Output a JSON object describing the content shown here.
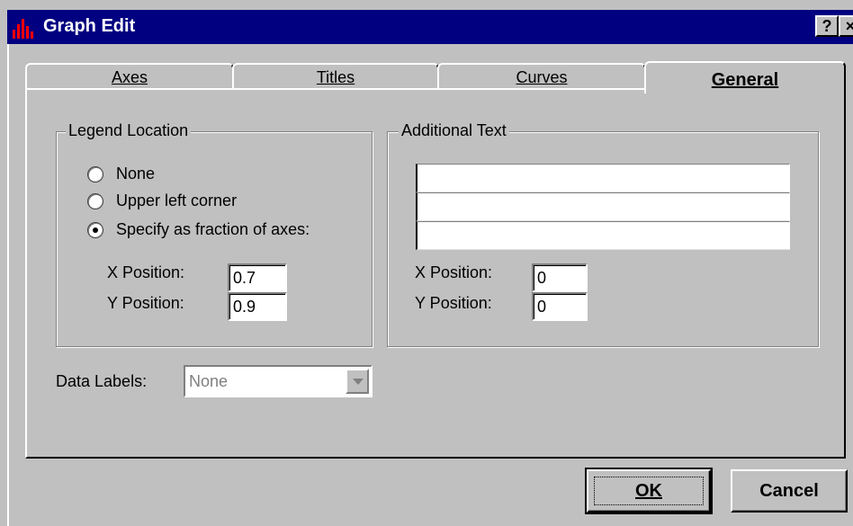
{
  "window": {
    "title": "Graph Edit",
    "icon": "bar-chart-icon",
    "help_label": "?",
    "close_label": "×"
  },
  "tabs": [
    {
      "label": "Axes",
      "selected": false
    },
    {
      "label": "Titles",
      "selected": false
    },
    {
      "label": "Curves",
      "selected": false
    },
    {
      "label": "General",
      "selected": true
    }
  ],
  "legend_location": {
    "group_title": "Legend Location",
    "options": [
      {
        "label": "None",
        "checked": false
      },
      {
        "label": "Upper left corner",
        "checked": false
      },
      {
        "label": "Specify as fraction of axes:",
        "checked": true
      }
    ],
    "x_label": "X Position:",
    "x_value": "0.7",
    "y_label": "Y Position:",
    "y_value": "0.9"
  },
  "additional_text": {
    "group_title": "Additional Text",
    "lines": [
      "",
      "",
      ""
    ],
    "x_label": "X Position:",
    "x_value": "0",
    "y_label": "Y Position:",
    "y_value": "0"
  },
  "data_labels": {
    "label": "Data Labels:",
    "value": "None",
    "enabled": false
  },
  "buttons": {
    "ok": "OK",
    "cancel": "Cancel"
  },
  "colors": {
    "title_bar": "#000080",
    "face": "#c0c0c0",
    "icon_red": "#ff0000"
  }
}
